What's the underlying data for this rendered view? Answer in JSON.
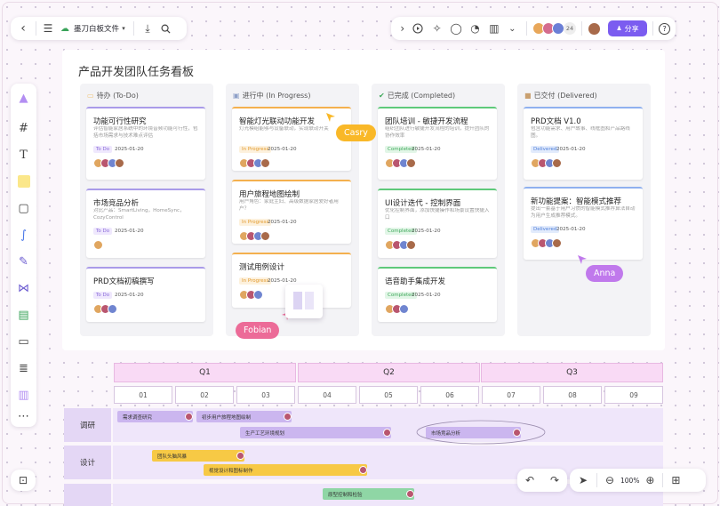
{
  "toolbar": {
    "filename": "墨刀白板文件",
    "collab_count": "24",
    "share_label": "分享",
    "help": "?"
  },
  "board": {
    "title": "产品开发团队任务看板"
  },
  "columns": [
    {
      "title": "待办 (To-Do)",
      "icon": "note-icon",
      "cards": [
        {
          "title": "功能可行性研究",
          "desc": "评估智能家居系统中的环境音频功能可行性，包括市场需求与技术难点评估",
          "tag": "To Do",
          "date": "2025-01-20"
        },
        {
          "title": "市场竞品分析",
          "desc": "对比产品：SmartLiving，HomeSync，CozyControl",
          "tag": "To Do",
          "date": "2025-01-20"
        },
        {
          "title": "PRD文档初稿撰写",
          "desc": "",
          "tag": "To Do",
          "date": "2025-01-20"
        }
      ]
    },
    {
      "title": "进行中 (In Progress)",
      "icon": "progress-icon",
      "cards": [
        {
          "title": "智能灯光联动功能开发",
          "desc": "灯光模组能够与设备联动，实现联动开关",
          "tag": "In Progress",
          "date": "2025-01-20"
        },
        {
          "title": "用户旅程地图绘制",
          "desc": "用户角色：家庭主妇、高级数据家居爱好者用户？",
          "tag": "In Progress",
          "date": "2025-01-20"
        },
        {
          "title": "测试用例设计",
          "desc": "",
          "tag": "In Progress",
          "date": "2025-01-20"
        }
      ]
    },
    {
      "title": "已完成 (Completed)",
      "icon": "check-icon",
      "cards": [
        {
          "title": "团队培训 - 敏捷开发流程",
          "desc": "组织团队进行敏捷开发流程的培训，提升团队的协作效率",
          "tag": "Completed",
          "date": "2025-01-20"
        },
        {
          "title": "UI设计迭代 - 控制界面",
          "desc": "优化控制界面，添加快捷操作和场景设置快捷入口",
          "tag": "Completed",
          "date": "2025-01-20"
        },
        {
          "title": "语音助手集成开发",
          "desc": "",
          "tag": "Completed",
          "date": "2025-01-20"
        }
      ]
    },
    {
      "title": "已交付 (Delivered)",
      "icon": "box-icon",
      "cards": [
        {
          "title": "PRD文档 V1.0",
          "desc": "包含功能需求、用户故事、线框图和产品路线图。",
          "tag": "Delivered",
          "date": "2025-01-20"
        },
        {
          "title": "新功能提案：智能模式推荐",
          "desc": "提出一套基于用户习惯的智能模式推荐算法自动为用户生成推荐模式。",
          "tag": "Delivered",
          "date": "2025-01-20"
        }
      ]
    }
  ],
  "cursors": {
    "casry": "Casry",
    "fobian": "Fobian",
    "anna": "Anna"
  },
  "gantt": {
    "quarters": [
      "Q1",
      "Q2",
      "Q3"
    ],
    "months": [
      "01",
      "02",
      "03",
      "04",
      "05",
      "06",
      "07",
      "08",
      "09"
    ],
    "rows": [
      "调研",
      "设计",
      ""
    ],
    "tasks": [
      "需求调查研究",
      "初步用户旅程地图绘制",
      "生产工艺环境规划",
      "市场竞品分析",
      "团队头脑风暴",
      "视觉设计和图标制作",
      "原型控制和检验"
    ]
  },
  "zoom": "100%",
  "colors": {
    "todo": "#a99be9",
    "progress": "#f4b04e",
    "completed": "#5ec97a",
    "delivered": "#8fb0ef",
    "accent": "#7b5cf0",
    "casry": "#f9b828",
    "fobian": "#ec6b98",
    "anna": "#c079ec"
  }
}
